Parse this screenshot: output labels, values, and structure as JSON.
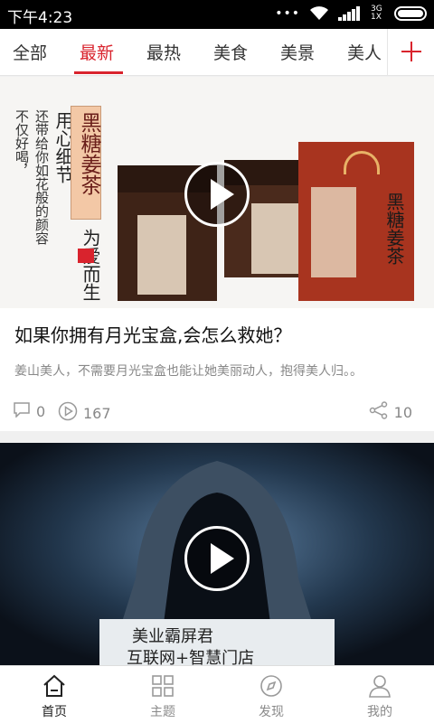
{
  "status_bar": {
    "time": "下午4:23",
    "network": "3G 1X"
  },
  "tabs": [
    {
      "label": "全部",
      "active": false
    },
    {
      "label": "最新",
      "active": true
    },
    {
      "label": "最热",
      "active": false
    },
    {
      "label": "美食",
      "active": false
    },
    {
      "label": "美景",
      "active": false
    },
    {
      "label": "美人",
      "active": false
    }
  ],
  "feed": [
    {
      "image_text": {
        "product_name": "黑糖姜茶",
        "slogan_1": "用心细节",
        "slogan_2": "为爱而生",
        "tagline_1": "不仅好喝，",
        "tagline_2": "还带给你如花般的颜容",
        "bag_text": "黑糖姜茶"
      },
      "title": "如果你拥有月光宝盒,会怎么救她？",
      "description": "姜山美人，不需要月光宝盒也能让她美丽动人，抱得美人归。。",
      "comments": "0",
      "plays": "167",
      "shares": "10"
    },
    {
      "image_text": {
        "line_1": "美业霸屏君",
        "line_2": "互联网+智慧门店"
      }
    }
  ],
  "bottom_nav": [
    {
      "label": "首页",
      "icon": "home-icon",
      "active": true
    },
    {
      "label": "主题",
      "icon": "grid-icon",
      "active": false
    },
    {
      "label": "发现",
      "icon": "compass-icon",
      "active": false
    },
    {
      "label": "我的",
      "icon": "user-icon",
      "active": false
    }
  ],
  "colors": {
    "accent": "#d9232d"
  }
}
